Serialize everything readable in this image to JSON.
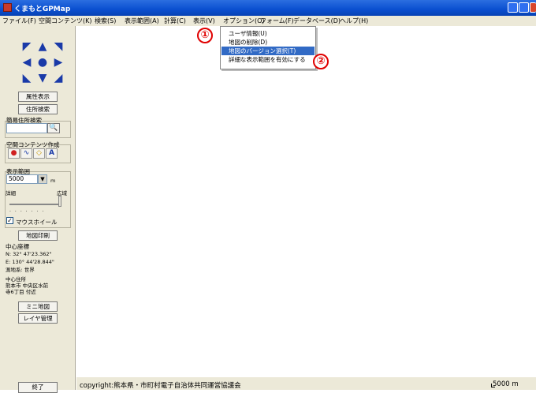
{
  "window": {
    "title": "くまもとGPMap"
  },
  "menubar": {
    "items": [
      "ファイル(F)",
      "空間コンテンツ(K)",
      "検索(S)",
      "表示範囲(A)",
      "計算(C)",
      "表示(V)",
      "オプション(O)",
      "フォーム(F)",
      "データベース(D)",
      "ヘルプ(H)"
    ]
  },
  "dropdown": {
    "items": [
      {
        "label": "ユーザ情報(U)",
        "highlighted": false
      },
      {
        "label": "地図の削除(D)",
        "highlighted": false
      },
      {
        "label": "地図のバージョン選択(T)",
        "highlighted": true
      },
      {
        "label": "詳細な表示範囲を有効にする",
        "highlighted": false
      }
    ]
  },
  "markers": {
    "one": "①",
    "two": "②"
  },
  "sidebar": {
    "attr_button": "属性表示",
    "address_search_button": "住所検索",
    "simple_search_label": "簡易住所検索",
    "content_create_label": "空間コンテンツ作成",
    "display_range_label": "表示範囲",
    "scale_value": "5000",
    "scale_unit": "m",
    "detail_label": "詳細",
    "wide_label": "広域",
    "mouse_wheel_label": "マウスホイール",
    "print_button": "地図印刷",
    "center_coords_label": "中心座標",
    "lat": "N:  32°  47'23.362\"",
    "lon": "E: 130°  44'28.844\"",
    "datum": "測地系:  世界",
    "center_address_label": "中心住所",
    "center_address_1": "熊本市 中央区水前",
    "center_address_2": "寺6丁目 付近",
    "mini_map_button": "ミニ地図",
    "layer_button": "レイヤ管理",
    "exit_button": "終了"
  },
  "statusbar": {
    "copyright": "copyright:熊本県・市町村電子自治体共同運営協議会",
    "scale": "5000 m"
  },
  "colors": {
    "highlight": "#316ac5",
    "marker": "#e00000",
    "arrow": "#1a3aa8"
  }
}
